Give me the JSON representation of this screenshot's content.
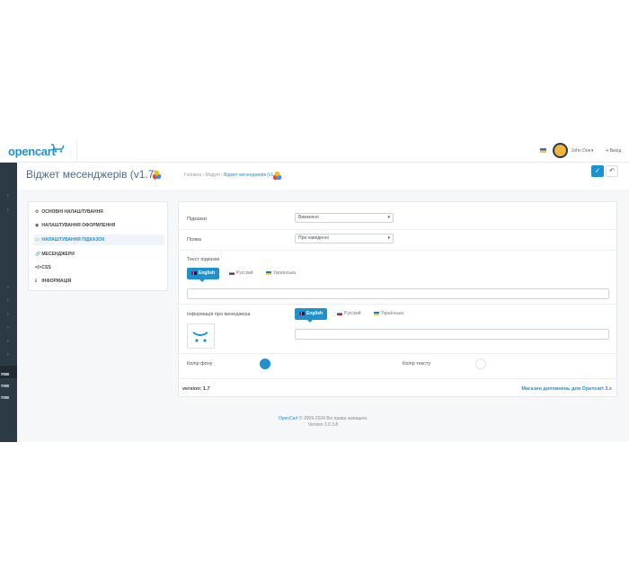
{
  "header": {
    "logo_text": "opencart",
    "user_name": "John Doe",
    "user_caret": "▾",
    "logout_label": "Вихід",
    "logout_icon": "sign-out-icon"
  },
  "sidebar": {
    "arrows": [
      "›",
      "›",
      "›",
      "›",
      "›",
      "›",
      "›",
      "›",
      "›",
      "›"
    ],
    "bars": [
      "0%",
      "0%",
      "0%"
    ]
  },
  "page": {
    "title": "Віджет месенджерів (v1.7)",
    "breadcrumb": {
      "home": "Головна",
      "sep": "›",
      "modules": "Модулі",
      "current": "Віджет месенджерів (v1.7)"
    },
    "save_icon": "✓",
    "back_icon": "↶"
  },
  "menu": {
    "items": [
      {
        "icon": "⚙",
        "label": "ОСНОВНІ НАЛАШТУВАННЯ"
      },
      {
        "icon": "◉",
        "label": "НАЛАШТУВАННЯ ОФОРМЛЕННЯ"
      },
      {
        "icon": "▭",
        "label": "НАЛАШТУВАННЯ ПІДКАЗОК"
      },
      {
        "icon": "🔗",
        "label": "МЕСЕНДЖЕРИ"
      },
      {
        "icon": "</>",
        "label": "CSS"
      },
      {
        "icon": "ℹ",
        "label": "ІНФОРМАЦІЯ"
      }
    ]
  },
  "form": {
    "tooltips_label": "Підказки",
    "tooltips_value": "Вимкнено",
    "show_label": "Поява",
    "show_value": "При наведенні",
    "tooltip_text_label": "Текст підказки",
    "manager_info_label": "Інформація про менеджера",
    "bg_color_label": "Колір фону",
    "text_color_label": "Колір тексту",
    "caret": "▾",
    "languages": [
      "English",
      "Русский",
      "Українська"
    ]
  },
  "panel_footer": {
    "version": "version: 1.7",
    "store_link": "Магазин доповнень для Opencart 3.x"
  },
  "footer": {
    "brand": "OpenCart",
    "copyright": "© 2009-2024 Всі права захищені.",
    "version": "Version 3.0.3.8"
  },
  "colors": {
    "accent": "#1e91cf",
    "bg_color_value": "#1e91cf",
    "text_color_value": "#ffffff"
  }
}
